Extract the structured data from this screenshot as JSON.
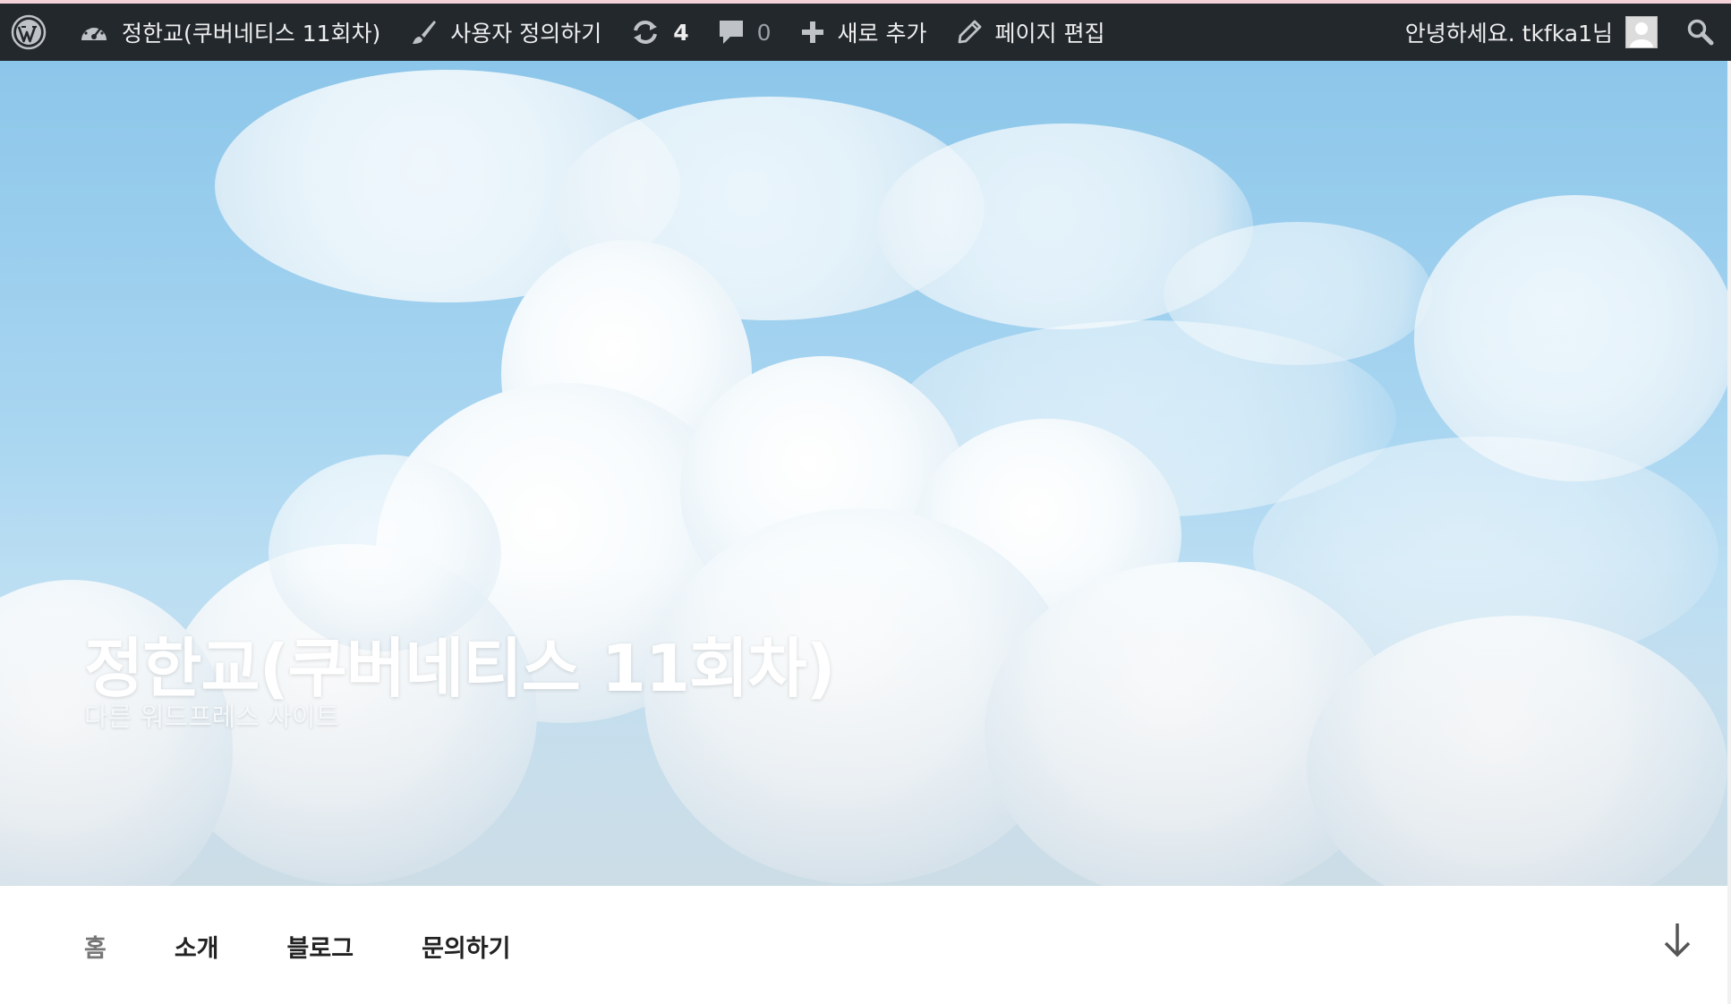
{
  "adminbar": {
    "site_name": "정한교(쿠버네티스 11회차)",
    "customize_label": "사용자 정의하기",
    "updates_count": "4",
    "comments_count": "0",
    "new_label": "새로 추가",
    "edit_page_label": "페이지 편집",
    "greeting": "안녕하세요. tkfka1님",
    "icons": {
      "wp": "wordpress-logo-icon",
      "dashboard": "dashboard-gauge-icon",
      "customize": "paintbrush-icon",
      "updates": "refresh-icon",
      "comments": "comment-bubble-icon",
      "new": "plus-icon",
      "edit": "pencil-icon",
      "search": "search-icon"
    },
    "colors": {
      "background": "#23282d",
      "text": "#eeeeee",
      "top_border": "#f3d2d8"
    }
  },
  "hero": {
    "title": "정한교(쿠버네티스 11회차)",
    "tagline": "다른 워드프레스 사이트",
    "colors": {
      "sky": "#8cc6ea"
    }
  },
  "nav": {
    "items": [
      {
        "label": "홈",
        "current": true
      },
      {
        "label": "소개",
        "current": false
      },
      {
        "label": "블로그",
        "current": false
      },
      {
        "label": "문의하기",
        "current": false
      }
    ],
    "scroll_icon": "arrow-down-icon"
  }
}
